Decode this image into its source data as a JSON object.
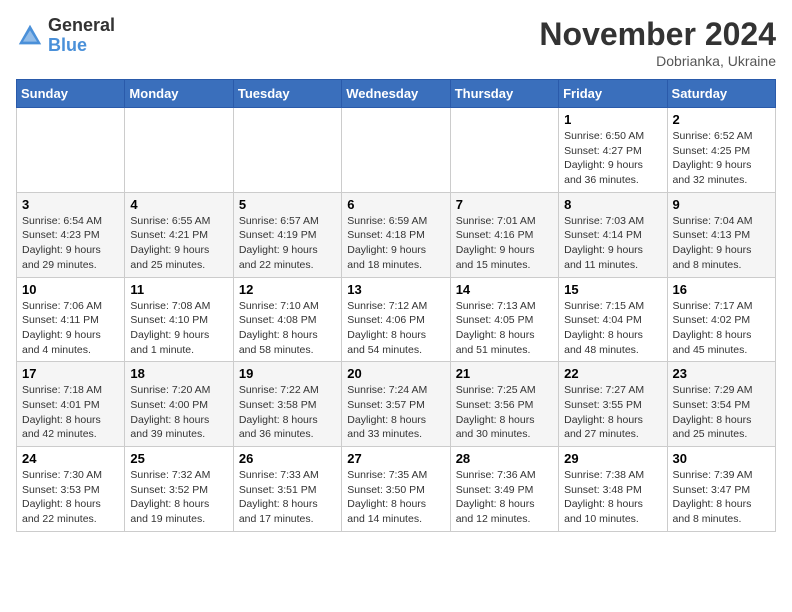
{
  "logo": {
    "general": "General",
    "blue": "Blue"
  },
  "header": {
    "month": "November 2024",
    "location": "Dobrianka, Ukraine"
  },
  "weekdays": [
    "Sunday",
    "Monday",
    "Tuesday",
    "Wednesday",
    "Thursday",
    "Friday",
    "Saturday"
  ],
  "weeks": [
    [
      {
        "day": "",
        "sunrise": "",
        "sunset": "",
        "daylight": ""
      },
      {
        "day": "",
        "sunrise": "",
        "sunset": "",
        "daylight": ""
      },
      {
        "day": "",
        "sunrise": "",
        "sunset": "",
        "daylight": ""
      },
      {
        "day": "",
        "sunrise": "",
        "sunset": "",
        "daylight": ""
      },
      {
        "day": "",
        "sunrise": "",
        "sunset": "",
        "daylight": ""
      },
      {
        "day": "1",
        "sunrise": "Sunrise: 6:50 AM",
        "sunset": "Sunset: 4:27 PM",
        "daylight": "Daylight: 9 hours and 36 minutes."
      },
      {
        "day": "2",
        "sunrise": "Sunrise: 6:52 AM",
        "sunset": "Sunset: 4:25 PM",
        "daylight": "Daylight: 9 hours and 32 minutes."
      }
    ],
    [
      {
        "day": "3",
        "sunrise": "Sunrise: 6:54 AM",
        "sunset": "Sunset: 4:23 PM",
        "daylight": "Daylight: 9 hours and 29 minutes."
      },
      {
        "day": "4",
        "sunrise": "Sunrise: 6:55 AM",
        "sunset": "Sunset: 4:21 PM",
        "daylight": "Daylight: 9 hours and 25 minutes."
      },
      {
        "day": "5",
        "sunrise": "Sunrise: 6:57 AM",
        "sunset": "Sunset: 4:19 PM",
        "daylight": "Daylight: 9 hours and 22 minutes."
      },
      {
        "day": "6",
        "sunrise": "Sunrise: 6:59 AM",
        "sunset": "Sunset: 4:18 PM",
        "daylight": "Daylight: 9 hours and 18 minutes."
      },
      {
        "day": "7",
        "sunrise": "Sunrise: 7:01 AM",
        "sunset": "Sunset: 4:16 PM",
        "daylight": "Daylight: 9 hours and 15 minutes."
      },
      {
        "day": "8",
        "sunrise": "Sunrise: 7:03 AM",
        "sunset": "Sunset: 4:14 PM",
        "daylight": "Daylight: 9 hours and 11 minutes."
      },
      {
        "day": "9",
        "sunrise": "Sunrise: 7:04 AM",
        "sunset": "Sunset: 4:13 PM",
        "daylight": "Daylight: 9 hours and 8 minutes."
      }
    ],
    [
      {
        "day": "10",
        "sunrise": "Sunrise: 7:06 AM",
        "sunset": "Sunset: 4:11 PM",
        "daylight": "Daylight: 9 hours and 4 minutes."
      },
      {
        "day": "11",
        "sunrise": "Sunrise: 7:08 AM",
        "sunset": "Sunset: 4:10 PM",
        "daylight": "Daylight: 9 hours and 1 minute."
      },
      {
        "day": "12",
        "sunrise": "Sunrise: 7:10 AM",
        "sunset": "Sunset: 4:08 PM",
        "daylight": "Daylight: 8 hours and 58 minutes."
      },
      {
        "day": "13",
        "sunrise": "Sunrise: 7:12 AM",
        "sunset": "Sunset: 4:06 PM",
        "daylight": "Daylight: 8 hours and 54 minutes."
      },
      {
        "day": "14",
        "sunrise": "Sunrise: 7:13 AM",
        "sunset": "Sunset: 4:05 PM",
        "daylight": "Daylight: 8 hours and 51 minutes."
      },
      {
        "day": "15",
        "sunrise": "Sunrise: 7:15 AM",
        "sunset": "Sunset: 4:04 PM",
        "daylight": "Daylight: 8 hours and 48 minutes."
      },
      {
        "day": "16",
        "sunrise": "Sunrise: 7:17 AM",
        "sunset": "Sunset: 4:02 PM",
        "daylight": "Daylight: 8 hours and 45 minutes."
      }
    ],
    [
      {
        "day": "17",
        "sunrise": "Sunrise: 7:18 AM",
        "sunset": "Sunset: 4:01 PM",
        "daylight": "Daylight: 8 hours and 42 minutes."
      },
      {
        "day": "18",
        "sunrise": "Sunrise: 7:20 AM",
        "sunset": "Sunset: 4:00 PM",
        "daylight": "Daylight: 8 hours and 39 minutes."
      },
      {
        "day": "19",
        "sunrise": "Sunrise: 7:22 AM",
        "sunset": "Sunset: 3:58 PM",
        "daylight": "Daylight: 8 hours and 36 minutes."
      },
      {
        "day": "20",
        "sunrise": "Sunrise: 7:24 AM",
        "sunset": "Sunset: 3:57 PM",
        "daylight": "Daylight: 8 hours and 33 minutes."
      },
      {
        "day": "21",
        "sunrise": "Sunrise: 7:25 AM",
        "sunset": "Sunset: 3:56 PM",
        "daylight": "Daylight: 8 hours and 30 minutes."
      },
      {
        "day": "22",
        "sunrise": "Sunrise: 7:27 AM",
        "sunset": "Sunset: 3:55 PM",
        "daylight": "Daylight: 8 hours and 27 minutes."
      },
      {
        "day": "23",
        "sunrise": "Sunrise: 7:29 AM",
        "sunset": "Sunset: 3:54 PM",
        "daylight": "Daylight: 8 hours and 25 minutes."
      }
    ],
    [
      {
        "day": "24",
        "sunrise": "Sunrise: 7:30 AM",
        "sunset": "Sunset: 3:53 PM",
        "daylight": "Daylight: 8 hours and 22 minutes."
      },
      {
        "day": "25",
        "sunrise": "Sunrise: 7:32 AM",
        "sunset": "Sunset: 3:52 PM",
        "daylight": "Daylight: 8 hours and 19 minutes."
      },
      {
        "day": "26",
        "sunrise": "Sunrise: 7:33 AM",
        "sunset": "Sunset: 3:51 PM",
        "daylight": "Daylight: 8 hours and 17 minutes."
      },
      {
        "day": "27",
        "sunrise": "Sunrise: 7:35 AM",
        "sunset": "Sunset: 3:50 PM",
        "daylight": "Daylight: 8 hours and 14 minutes."
      },
      {
        "day": "28",
        "sunrise": "Sunrise: 7:36 AM",
        "sunset": "Sunset: 3:49 PM",
        "daylight": "Daylight: 8 hours and 12 minutes."
      },
      {
        "day": "29",
        "sunrise": "Sunrise: 7:38 AM",
        "sunset": "Sunset: 3:48 PM",
        "daylight": "Daylight: 8 hours and 10 minutes."
      },
      {
        "day": "30",
        "sunrise": "Sunrise: 7:39 AM",
        "sunset": "Sunset: 3:47 PM",
        "daylight": "Daylight: 8 hours and 8 minutes."
      }
    ]
  ]
}
